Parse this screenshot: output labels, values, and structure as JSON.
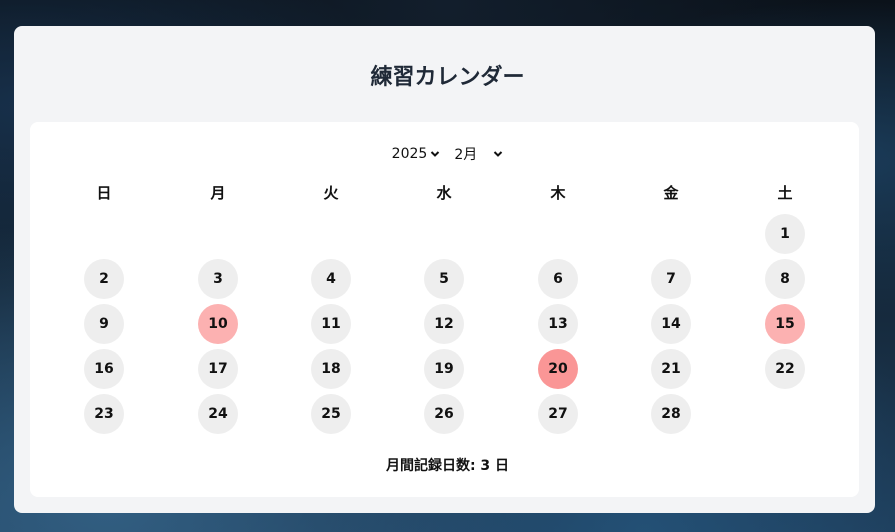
{
  "title": "練習カレンダー",
  "selectors": {
    "year": "2025",
    "month": "2月"
  },
  "weekdays": [
    "日",
    "月",
    "火",
    "水",
    "木",
    "金",
    "土"
  ],
  "calendar": {
    "first_weekday_index": 6,
    "days": [
      {
        "day": "1",
        "level": 0
      },
      {
        "day": "2",
        "level": 0
      },
      {
        "day": "3",
        "level": 0
      },
      {
        "day": "4",
        "level": 0
      },
      {
        "day": "5",
        "level": 0
      },
      {
        "day": "6",
        "level": 0
      },
      {
        "day": "7",
        "level": 0
      },
      {
        "day": "8",
        "level": 0
      },
      {
        "day": "9",
        "level": 0
      },
      {
        "day": "10",
        "level": 1
      },
      {
        "day": "11",
        "level": 0
      },
      {
        "day": "12",
        "level": 0
      },
      {
        "day": "13",
        "level": 0
      },
      {
        "day": "14",
        "level": 0
      },
      {
        "day": "15",
        "level": 1
      },
      {
        "day": "16",
        "level": 0
      },
      {
        "day": "17",
        "level": 0
      },
      {
        "day": "18",
        "level": 0
      },
      {
        "day": "19",
        "level": 0
      },
      {
        "day": "20",
        "level": 2
      },
      {
        "day": "21",
        "level": 0
      },
      {
        "day": "22",
        "level": 0
      },
      {
        "day": "23",
        "level": 0
      },
      {
        "day": "24",
        "level": 0
      },
      {
        "day": "25",
        "level": 0
      },
      {
        "day": "26",
        "level": 0
      },
      {
        "day": "27",
        "level": 0
      },
      {
        "day": "28",
        "level": 0
      }
    ]
  },
  "colors": {
    "empty": "#eeeeee",
    "level_1": "#fcb1b1",
    "level_2": "#fa9696"
  },
  "summary": "月間記録日数: 3 日"
}
